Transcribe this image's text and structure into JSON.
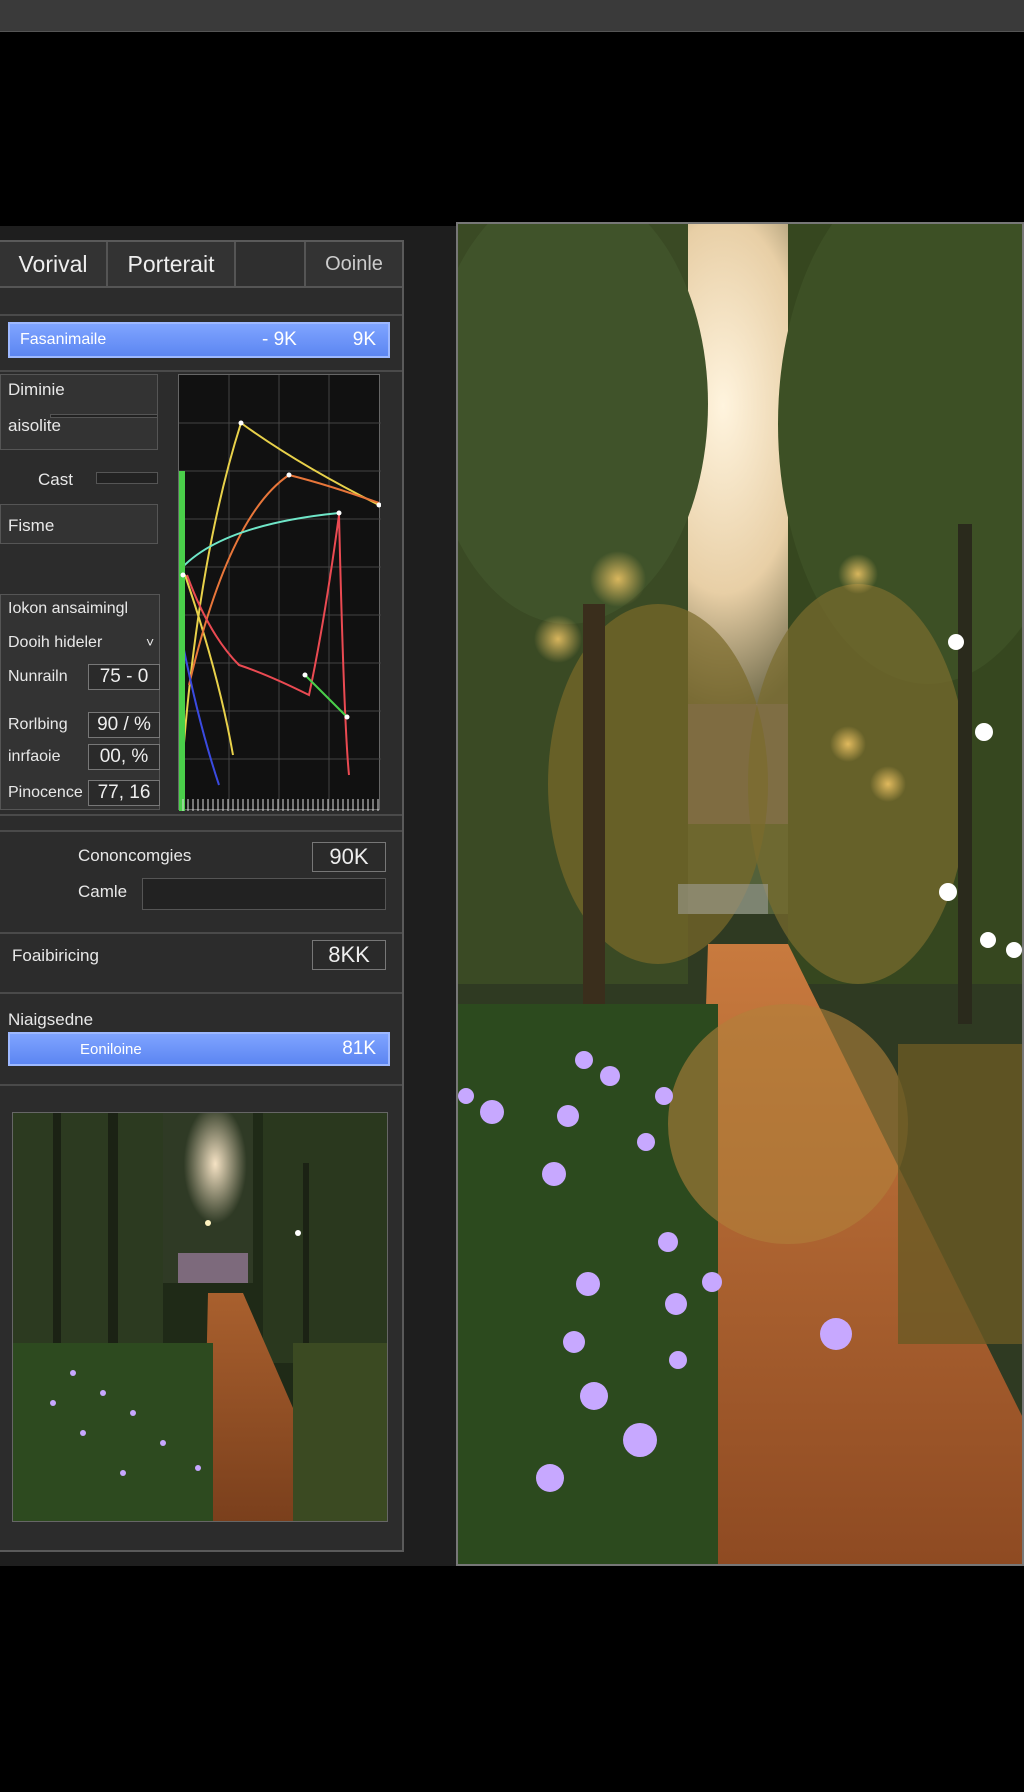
{
  "tabs": [
    "Vorival",
    "Porterait",
    "",
    "Ooinle"
  ],
  "exposure_bar": {
    "label": "Fasanimaile",
    "value": "- 9K",
    "right": "9K"
  },
  "left_labels": {
    "dimmie": "Diminie",
    "absolute": "aisolite",
    "cast": "Cast",
    "fisme": "Fisme"
  },
  "rows": [
    {
      "label": "Iokon ansaimingl",
      "value": ""
    },
    {
      "label": "Dooih hideler",
      "value": "˅"
    },
    {
      "label": "Nunrailn",
      "value": "75 - 0"
    },
    {
      "label": "Rorlbing",
      "value": "90 / %"
    },
    {
      "label": "inrfaoie",
      "value": "00, %"
    },
    {
      "label": "Pinocence",
      "value": "77, 16"
    }
  ],
  "section2": {
    "label1": "Cononcomgies",
    "value1": "90K",
    "label2": "Camle",
    "label3": "Foaibiricing",
    "value3": "8KK"
  },
  "section3": {
    "title": "Niaigsedne",
    "bar_label": "Eoniloine",
    "bar_value": "81K"
  },
  "curves": {
    "yellow": "#e8d14a",
    "orange": "#e8763a",
    "red": "#ea4a52",
    "cyan": "#6fe6c8",
    "green": "#4acf4a",
    "blue": "#3a4ae0"
  }
}
